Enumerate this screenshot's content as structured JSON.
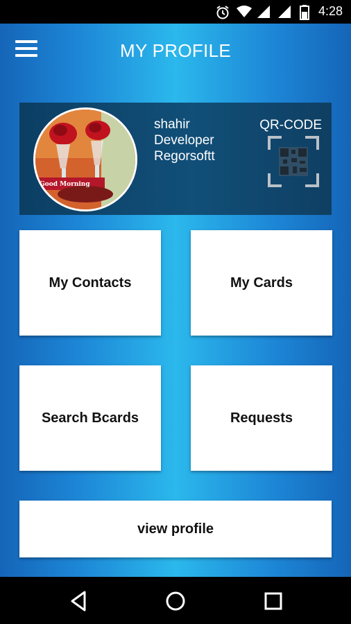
{
  "status_bar": {
    "time": "4:28",
    "icons": [
      "alarm-icon",
      "wifi-icon",
      "signal-icon",
      "signal-icon",
      "battery-icon"
    ]
  },
  "header": {
    "title": "MY PROFILE",
    "menu_icon": "menu-icon"
  },
  "profile": {
    "name": "shahir",
    "role": "Developer",
    "company": "Regorsoftt",
    "avatar_caption": "Good Morning",
    "qr_label": "QR-CODE",
    "qr_icon": "qr-code-icon"
  },
  "tiles": [
    {
      "label": "My Contacts"
    },
    {
      "label": "My Cards"
    },
    {
      "label": "Search Bcards"
    },
    {
      "label": "Requests"
    }
  ],
  "view_profile": {
    "label": "view profile"
  },
  "nav_bar": {
    "icons": [
      "back-icon",
      "home-icon",
      "recents-icon"
    ]
  },
  "colors": {
    "status_bar": "#000000",
    "background_center": "#2bb8ec",
    "background_edge": "#1565b8",
    "profile_card": "#114f78",
    "tile": "#ffffff"
  }
}
